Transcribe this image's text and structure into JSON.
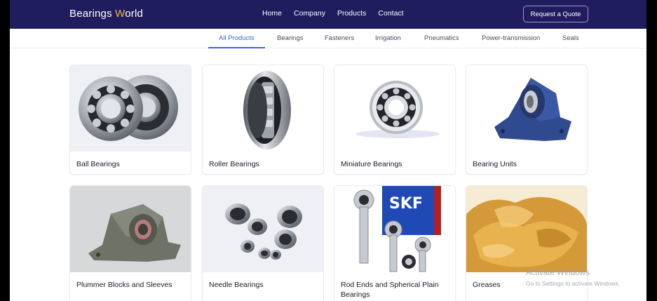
{
  "brand": {
    "part1": "Bearings ",
    "accent": "W",
    "part2": "orld"
  },
  "nav": [
    {
      "label": "Home"
    },
    {
      "label": "Company"
    },
    {
      "label": "Products"
    },
    {
      "label": "Contact"
    }
  ],
  "quote_button": "Request a Quote",
  "tabs": [
    {
      "label": "All Products",
      "active": true
    },
    {
      "label": "Bearings"
    },
    {
      "label": "Fasteners"
    },
    {
      "label": "Irrigation"
    },
    {
      "label": "Pneumatics"
    },
    {
      "label": "Power-transmission"
    },
    {
      "label": "Seals"
    }
  ],
  "products": [
    {
      "title": "Ball Bearings"
    },
    {
      "title": "Roller Bearings"
    },
    {
      "title": "Miniature Bearings"
    },
    {
      "title": "Bearing Units"
    },
    {
      "title": "Plummer Blocks and Sleeves"
    },
    {
      "title": "Needle Bearings"
    },
    {
      "title": "Rod Ends and Spherical Plain Bearings"
    },
    {
      "title": "Greases"
    }
  ],
  "product_image_text": {
    "skf": "SKF"
  },
  "watermark": {
    "line1": "Activate Windows",
    "line2": "Go to Settings to activate Windows."
  },
  "colors": {
    "navbar": "#1f1d5e",
    "accent": "#f0b93a",
    "tab_active": "#3a66d8"
  }
}
